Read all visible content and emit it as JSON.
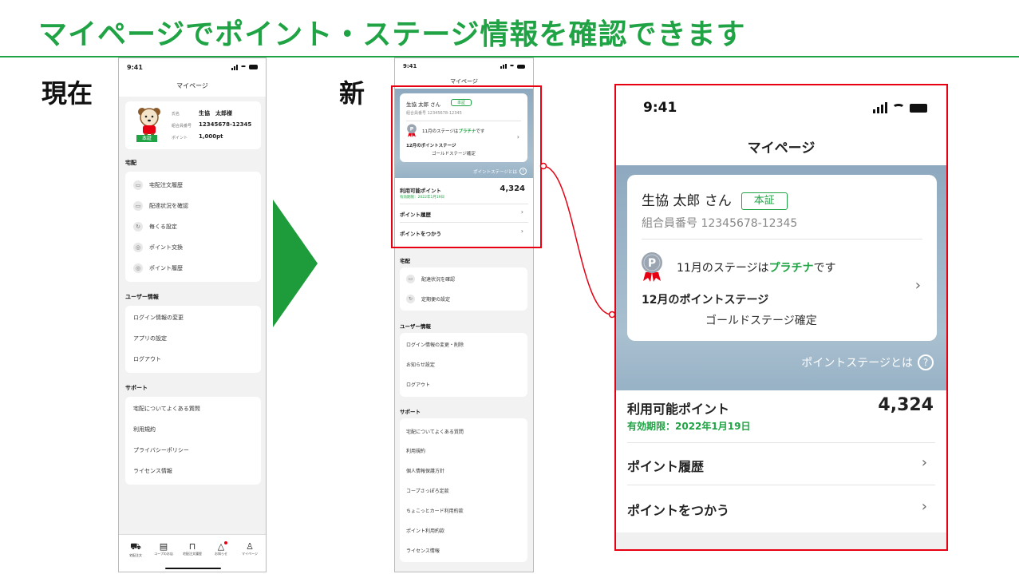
{
  "slide": {
    "title": "マイページでポイント・ステージ情報を確認できます",
    "label_current": "現在",
    "label_new": "新"
  },
  "current": {
    "time": "9:41",
    "nav_title": "マイページ",
    "profile": {
      "name_label": "氏名",
      "name_value": "生協　太郎様",
      "member_label": "組合員番号",
      "member_value": "12345678-12345",
      "point_label": "ポイント",
      "point_value": "1,000pt",
      "badge": "本証"
    },
    "sections": [
      {
        "head": "宅配",
        "items": [
          "宅配注文履歴",
          "配達状況を確認",
          "毎くる設定",
          "ポイント交換",
          "ポイント履歴"
        ]
      },
      {
        "head": "ユーザー情報",
        "items": [
          "ログイン情報の変更",
          "アプリの設定",
          "ログアウト"
        ]
      },
      {
        "head": "サポート",
        "items": [
          "宅配についてよくある質問",
          "利用規約",
          "プライバシーポリシー",
          "ライセンス情報"
        ]
      }
    ],
    "tabs": [
      "宅配注文",
      "コープのお店",
      "宅配注文履歴",
      "お知らせ",
      "マイページ"
    ]
  },
  "new": {
    "time": "9:41",
    "nav_title": "マイページ",
    "name": "生協 太郎 さん",
    "badge": "本証",
    "member": "組合員番号 12345678-12345",
    "stage_now_pre": "11月のステージは",
    "stage_now_em": "プラチナ",
    "stage_now_post": "です",
    "stage_next": "12月のポイントステージ",
    "stage_conf": "ゴールドステージ確定",
    "about": "ポイントステージとは",
    "avail_label": "利用可能ポイント",
    "avail_value": "4,324",
    "expiry": "有効期限：2022年1月19日",
    "link_history": "ポイント履歴",
    "link_use": "ポイントをつかう",
    "sections": [
      {
        "head": "宅配",
        "items": [
          "配達状況を確認",
          "定期便の設定"
        ]
      },
      {
        "head": "ユーザー情報",
        "items": [
          "ログイン情報の変更・削除",
          "お知らせ設定",
          "ログアウト"
        ]
      },
      {
        "head": "サポート",
        "items": [
          "宅配についてよくある質問",
          "利用規約",
          "個人情報保護方針",
          "コープさっぽろ定款",
          "ちょこっとカード利用約款",
          "ポイント利用約款",
          "ライセンス情報"
        ]
      }
    ]
  },
  "detail": {
    "time": "9:41",
    "nav_title": "マイページ",
    "name": "生協 太郎 さん",
    "badge": "本証",
    "member": "組合員番号 12345678-12345",
    "stage_now_pre": "11月のステージは",
    "stage_now_em": "プラチナ",
    "stage_now_post": "です",
    "stage_next": "12月のポイントステージ",
    "stage_conf": "ゴールドステージ確定",
    "about": "ポイントステージとは",
    "avail_label": "利用可能ポイント",
    "avail_value": "4,324",
    "expiry": "有効期限：2022年1月19日",
    "link_history": "ポイント履歴",
    "link_use": "ポイントをつかう"
  },
  "icons": {
    "chevron": "›",
    "help": "?",
    "medal": "P"
  },
  "colors": {
    "brand_green": "#1fa344",
    "arrow_green": "#1e9b3a",
    "highlight_red": "#e60012"
  }
}
